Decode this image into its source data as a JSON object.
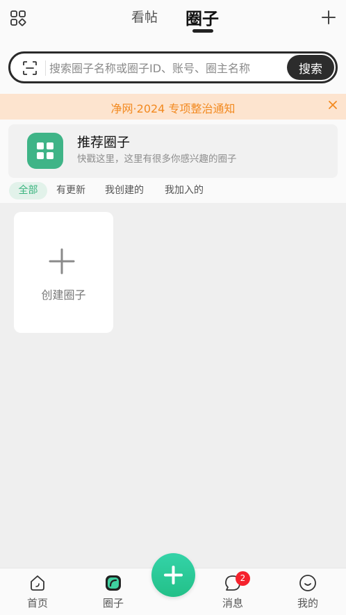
{
  "header": {
    "tabs": [
      {
        "label": "看帖",
        "active": false
      },
      {
        "label": "圈子",
        "active": true
      }
    ],
    "left_icon": "grid-apps-icon",
    "right_icon": "plus-icon"
  },
  "search": {
    "placeholder": "搜索圈子名称或圈子ID、账号、圈主名称",
    "value": "",
    "button_label": "搜索",
    "scan_icon": "scan-icon"
  },
  "notice": {
    "text": "净网·2024 专项整治通知",
    "close_icon": "close-icon"
  },
  "recommended": {
    "title": "推荐圈子",
    "subtitle": "快戳这里，这里有很多你感兴趣的圈子"
  },
  "filters": [
    {
      "label": "全部",
      "active": true
    },
    {
      "label": "有更新",
      "active": false
    },
    {
      "label": "我创建的",
      "active": false
    },
    {
      "label": "我加入的",
      "active": false
    }
  ],
  "create_card": {
    "label": "创建圈子"
  },
  "bottom_nav": {
    "items": [
      {
        "label": "首页",
        "icon": "home-icon"
      },
      {
        "label": "圈子",
        "icon": "circle-app-icon"
      },
      {
        "label": "消息",
        "icon": "message-icon",
        "badge": "2"
      },
      {
        "label": "我的",
        "icon": "smile-face-icon"
      }
    ],
    "fab_icon": "plus-icon"
  },
  "colors": {
    "accent": "#3fb487",
    "notice_text": "#f2891f",
    "notice_bg": "#fde4cf",
    "badge": "#f5222d"
  }
}
